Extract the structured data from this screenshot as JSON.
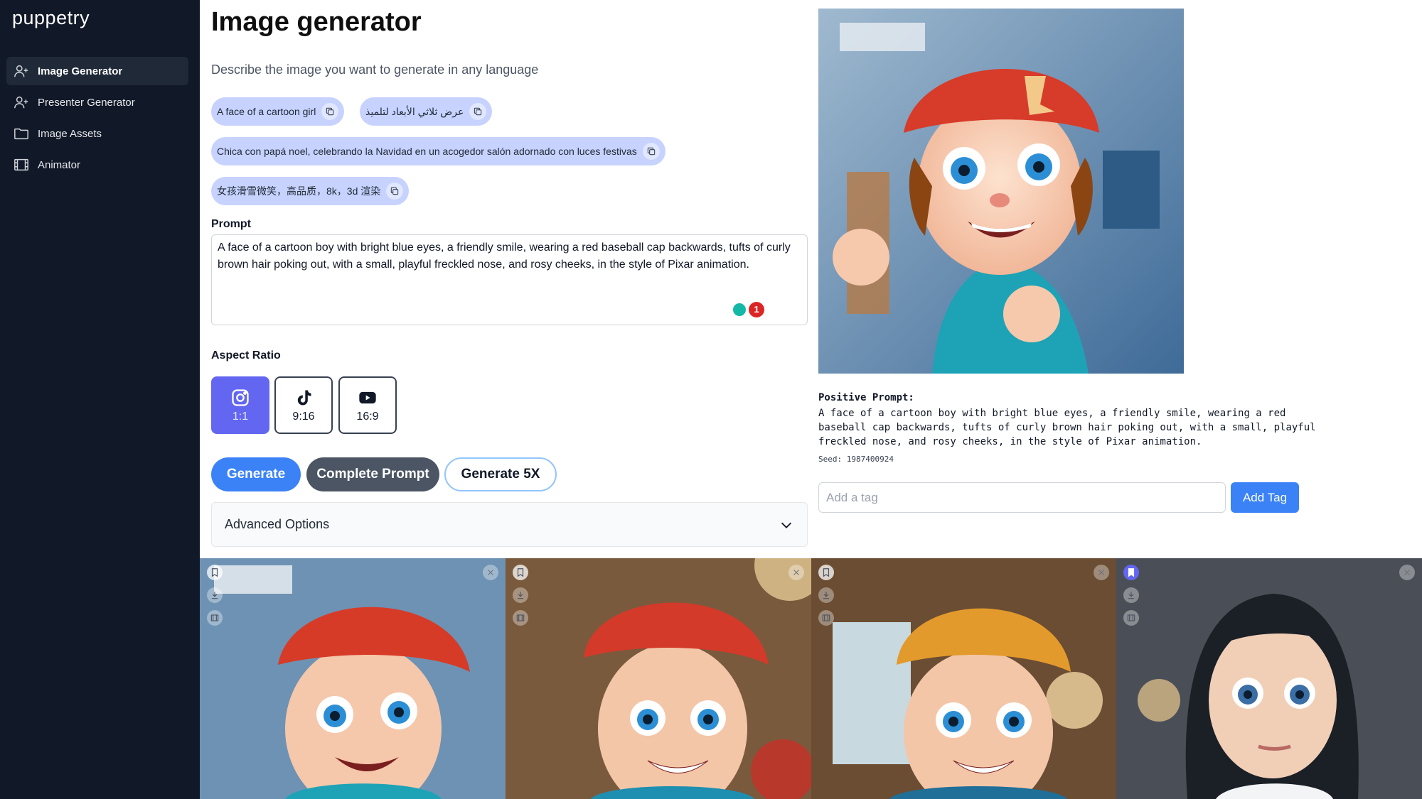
{
  "app": {
    "logo": "puppetry"
  },
  "sidebar": {
    "items": [
      {
        "label": "Image Generator",
        "icon": "user-plus-icon",
        "active": true
      },
      {
        "label": "Presenter Generator",
        "icon": "user-plus-icon",
        "active": false
      },
      {
        "label": "Image Assets",
        "icon": "folder-icon",
        "active": false
      },
      {
        "label": "Animator",
        "icon": "film-icon",
        "active": false
      }
    ]
  },
  "main": {
    "title": "Image generator",
    "subtitle": "Describe the image you want to generate in any language",
    "examples": [
      "A face of a cartoon girl",
      "عرض ثلاثي الأبعاد لتلميذ",
      "Chica con papá noel, celebrando la Navidad en un acogedor salón adornado con luces festivas",
      "女孩滑雪微笑，高品质，8k，3d 渲染"
    ],
    "prompt_label": "Prompt",
    "prompt_value": "A face of a cartoon boy with bright blue eyes, a friendly smile, wearing a red baseball cap backwards, tufts of curly brown hair poking out, with a small, playful freckled nose, and rosy cheeks, in the style of Pixar animation.",
    "grammar_count": "1",
    "aspect_label": "Aspect Ratio",
    "aspect_options": [
      {
        "label": "1:1",
        "icon": "instagram-icon",
        "selected": true
      },
      {
        "label": "9:16",
        "icon": "tiktok-icon",
        "selected": false
      },
      {
        "label": "16:9",
        "icon": "youtube-icon",
        "selected": false
      }
    ],
    "buttons": {
      "generate": "Generate",
      "complete": "Complete Prompt",
      "generate5x": "Generate 5X"
    },
    "advanced_label": "Advanced Options"
  },
  "result": {
    "positive_label": "Positive Prompt:",
    "positive_text": "A face of a cartoon boy with bright blue eyes, a friendly smile, wearing a red baseball cap backwards, tufts of curly brown hair poking out, with a small, playful freckled nose, and rosy cheeks, in the style of Pixar animation.",
    "seed": "Seed: 1987400924",
    "tag_placeholder": "Add a tag",
    "add_tag": "Add Tag"
  },
  "colors": {
    "sidebar": "#111827",
    "accent": "#3b82f6",
    "chip": "#c7d2fe",
    "ratio_active": "#6366f1"
  },
  "gallery": [
    {
      "subject": "cartoon boy with red cap",
      "bookmarked": false
    },
    {
      "subject": "cartoon boy with red cap",
      "bookmarked": false
    },
    {
      "subject": "cartoon boy with orange cap",
      "bookmarked": false
    },
    {
      "subject": "cartoon girl with dark hair",
      "bookmarked": true
    }
  ]
}
